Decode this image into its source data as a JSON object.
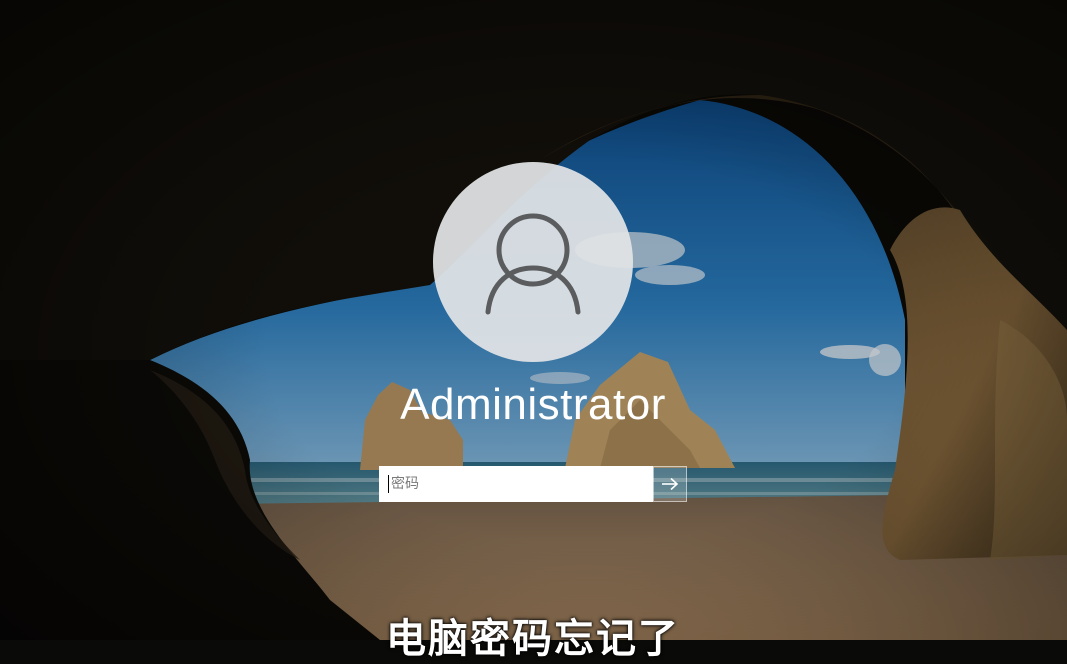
{
  "login": {
    "username": "Administrator",
    "password_placeholder": "密码",
    "password_value": ""
  },
  "caption": "电脑密码忘记了",
  "icons": {
    "avatar": "user-silhouette-icon",
    "submit": "arrow-right-icon"
  },
  "colors": {
    "avatar_bg": "#e2e4e6",
    "avatar_stroke": "#5a5c5e",
    "text": "#ffffff"
  }
}
